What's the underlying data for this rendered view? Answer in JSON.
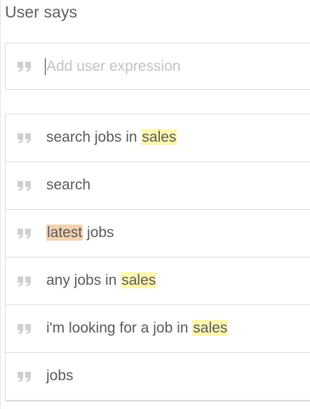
{
  "section": {
    "title": "User says"
  },
  "input": {
    "placeholder": "Add user expression",
    "value": ""
  },
  "icons": {
    "quote": "quote-icon"
  },
  "colors": {
    "entity_sales": "#fff6b0",
    "entity_latest": "#f4d3b2"
  },
  "expressions": [
    {
      "parts": [
        {
          "text": "search jobs in "
        },
        {
          "text": "sales",
          "entity": "sales"
        }
      ]
    },
    {
      "parts": [
        {
          "text": "search"
        }
      ]
    },
    {
      "parts": [
        {
          "text": "latest",
          "entity": "latest"
        },
        {
          "text": " jobs"
        }
      ]
    },
    {
      "parts": [
        {
          "text": "any jobs in "
        },
        {
          "text": "sales",
          "entity": "sales"
        }
      ]
    },
    {
      "parts": [
        {
          "text": "i'm looking for a job in "
        },
        {
          "text": "sales",
          "entity": "sales"
        }
      ]
    },
    {
      "parts": [
        {
          "text": "jobs"
        }
      ]
    }
  ]
}
